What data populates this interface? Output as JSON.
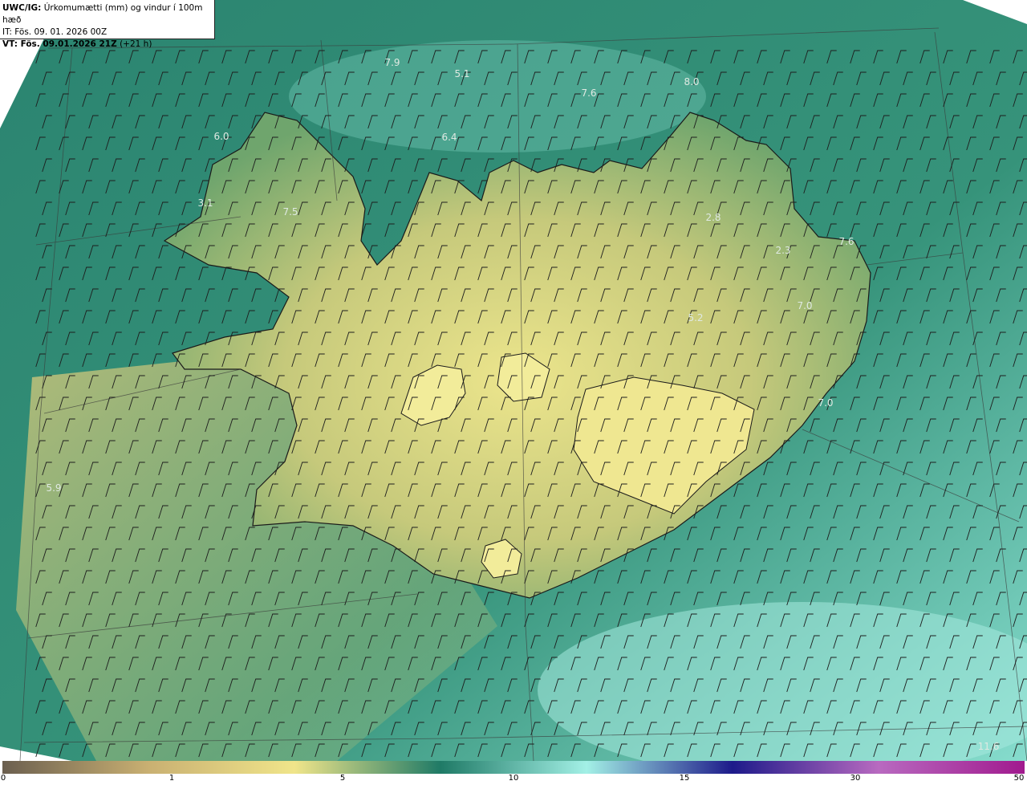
{
  "header": {
    "model": "UWC/IG:",
    "title": "Úrkomumætti (mm) og vindur í 100m hæð",
    "it_line": "IT: Fös. 09. 01. 2026 00Z",
    "vt_prefix": "VT: Fös. 09.01.2026 21Z",
    "vt_suffix": "(+21 h)"
  },
  "value_labels": [
    "7.9",
    "5.1",
    "7.6",
    "8.0",
    "6.0",
    "6.4",
    "3.1",
    "7.5",
    "2.8",
    "2.3",
    "7.6",
    "7.0",
    "5.2",
    "7.0",
    "5.9",
    "11.6"
  ],
  "scale": {
    "ticks": [
      "0",
      "1",
      "5",
      "10",
      "15",
      "30",
      "50"
    ],
    "colors": [
      "#6b5f4f",
      "#c9b072",
      "#f0e58a",
      "#1f7a66",
      "#a3f0e6",
      "#1d1a8a",
      "#b86ac0",
      "#a11a8e"
    ]
  },
  "colors": {
    "land_low": "#e9e28a",
    "land_mid": "#9cb86f",
    "sea": "#2e8a73",
    "sea_light": "#7fd2c2"
  }
}
